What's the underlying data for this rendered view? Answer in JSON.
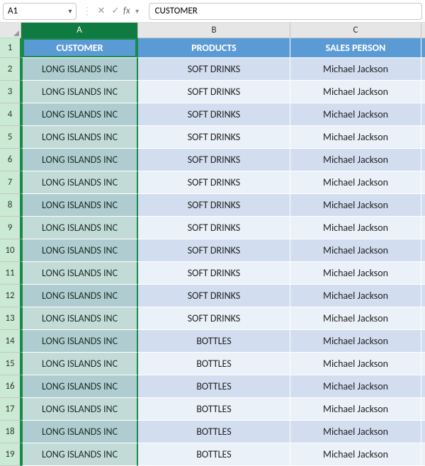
{
  "nameBox": {
    "value": "A1"
  },
  "formulaBar": {
    "cancelIcon": "✕",
    "acceptIcon": "✓",
    "fxLabel": "fx",
    "value": "CUSTOMER"
  },
  "columns": [
    "A",
    "B",
    "C"
  ],
  "headerRow": {
    "number": "1",
    "cells": [
      "CUSTOMER",
      "PRODUCTS",
      "SALES PERSON"
    ]
  },
  "rows": [
    {
      "n": "2",
      "a": "LONG ISLANDS INC",
      "b": "SOFT DRINKS",
      "c": "Michael Jackson"
    },
    {
      "n": "3",
      "a": "LONG ISLANDS INC",
      "b": "SOFT DRINKS",
      "c": "Michael Jackson"
    },
    {
      "n": "4",
      "a": "LONG ISLANDS INC",
      "b": "SOFT DRINKS",
      "c": "Michael Jackson"
    },
    {
      "n": "5",
      "a": "LONG ISLANDS INC",
      "b": "SOFT DRINKS",
      "c": "Michael Jackson"
    },
    {
      "n": "6",
      "a": "LONG ISLANDS INC",
      "b": "SOFT DRINKS",
      "c": "Michael Jackson"
    },
    {
      "n": "7",
      "a": "LONG ISLANDS INC",
      "b": "SOFT DRINKS",
      "c": "Michael Jackson"
    },
    {
      "n": "8",
      "a": "LONG ISLANDS INC",
      "b": "SOFT DRINKS",
      "c": "Michael Jackson"
    },
    {
      "n": "9",
      "a": "LONG ISLANDS INC",
      "b": "SOFT DRINKS",
      "c": "Michael Jackson"
    },
    {
      "n": "10",
      "a": "LONG ISLANDS INC",
      "b": "SOFT DRINKS",
      "c": "Michael Jackson"
    },
    {
      "n": "11",
      "a": "LONG ISLANDS INC",
      "b": "SOFT DRINKS",
      "c": "Michael Jackson"
    },
    {
      "n": "12",
      "a": "LONG ISLANDS INC",
      "b": "SOFT DRINKS",
      "c": "Michael Jackson"
    },
    {
      "n": "13",
      "a": "LONG ISLANDS INC",
      "b": "SOFT DRINKS",
      "c": "Michael Jackson"
    },
    {
      "n": "14",
      "a": "LONG ISLANDS INC",
      "b": "BOTTLES",
      "c": "Michael Jackson"
    },
    {
      "n": "15",
      "a": "LONG ISLANDS INC",
      "b": "BOTTLES",
      "c": "Michael Jackson"
    },
    {
      "n": "16",
      "a": "LONG ISLANDS INC",
      "b": "BOTTLES",
      "c": "Michael Jackson"
    },
    {
      "n": "17",
      "a": "LONG ISLANDS INC",
      "b": "BOTTLES",
      "c": "Michael Jackson"
    },
    {
      "n": "18",
      "a": "LONG ISLANDS INC",
      "b": "BOTTLES",
      "c": "Michael Jackson"
    },
    {
      "n": "19",
      "a": "LONG ISLANDS INC",
      "b": "BOTTLES",
      "c": "Michael Jackson"
    }
  ]
}
